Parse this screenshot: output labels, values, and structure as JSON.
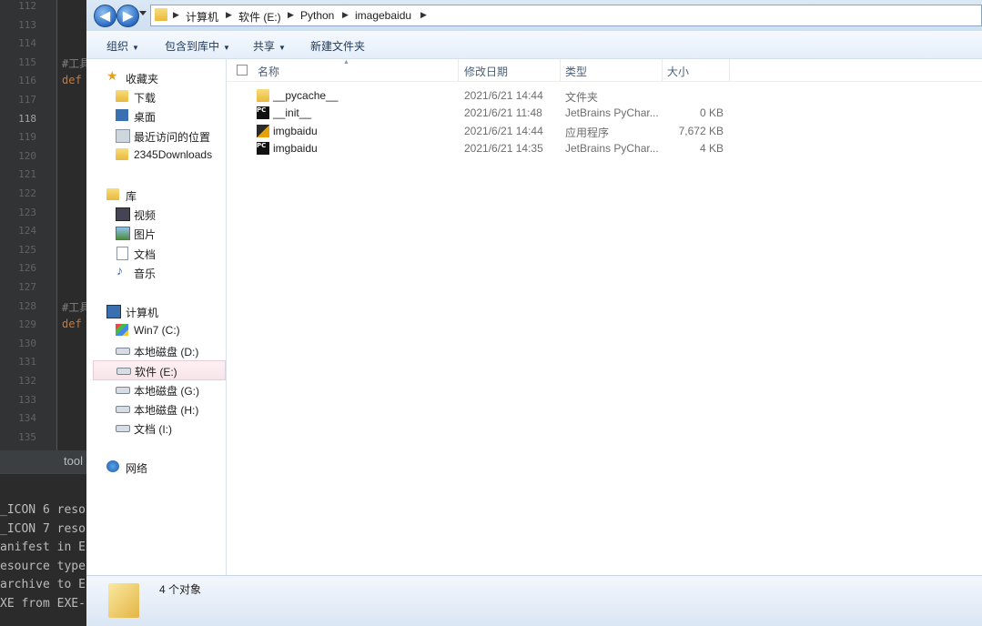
{
  "ide": {
    "line_numbers": [
      "112",
      "113",
      "114",
      "115",
      "116",
      "117",
      "118",
      "119",
      "120",
      "121",
      "122",
      "123",
      "124",
      "125",
      "126",
      "127",
      "128",
      "129",
      "130",
      "131",
      "132",
      "133",
      "134",
      "135"
    ],
    "current_line": "118",
    "code_fragments": [
      {
        "line": "115",
        "text": "#工具",
        "kind": "comment"
      },
      {
        "line": "116",
        "text": "def",
        "kind": "kw"
      },
      {
        "line": "128",
        "text": "#工具",
        "kind": "comment"
      },
      {
        "line": "129",
        "text": "def",
        "kind": "kw"
      }
    ],
    "tab_label": "tool",
    "console_lines": [
      "_ICON 6 reso",
      "_ICON 7 reso",
      "anifest in E",
      "esource type",
      "archive to E",
      "XE from EXE-"
    ]
  },
  "explorer": {
    "breadcrumb": [
      "计算机",
      "软件 (E:)",
      "Python",
      "imagebaidu"
    ],
    "toolbar": {
      "organize": "组织",
      "include_in_library": "包含到库中",
      "share": "共享",
      "new_folder": "新建文件夹"
    },
    "nav": {
      "favorites": "收藏夹",
      "favorites_items": [
        "下载",
        "桌面",
        "最近访问的位置",
        "2345Downloads"
      ],
      "libraries": "库",
      "libraries_items": [
        "视频",
        "图片",
        "文档",
        "音乐"
      ],
      "computer": "计算机",
      "computer_items": [
        "Win7 (C:)",
        "本地磁盘 (D:)",
        "软件 (E:)",
        "本地磁盘 (G:)",
        "本地磁盘 (H:)",
        "文档 (I:)"
      ],
      "selected": "软件 (E:)",
      "network": "网络"
    },
    "columns": {
      "name": "名称",
      "date": "修改日期",
      "type": "类型",
      "size": "大小"
    },
    "files": [
      {
        "name": "__pycache__",
        "date": "2021/6/21 14:44",
        "type": "文件夹",
        "size": "",
        "icon": "folder-icon"
      },
      {
        "name": "__init__",
        "date": "2021/6/21 11:48",
        "type": "JetBrains PyChar...",
        "size": "0 KB",
        "icon": "pycharm-file-icon"
      },
      {
        "name": "imgbaidu",
        "date": "2021/6/21 14:44",
        "type": "应用程序",
        "size": "7,672 KB",
        "icon": "application-icon"
      },
      {
        "name": "imgbaidu",
        "date": "2021/6/21 14:35",
        "type": "JetBrains PyChar...",
        "size": "4 KB",
        "icon": "pycharm-file-icon"
      }
    ],
    "status": "4 个对象"
  }
}
